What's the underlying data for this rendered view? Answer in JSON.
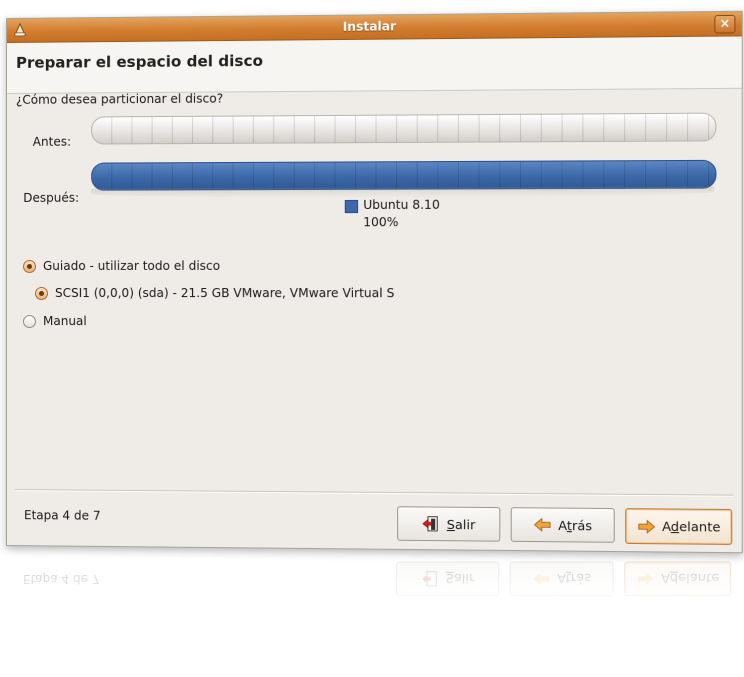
{
  "window": {
    "title": "Instalar",
    "close_label": "×"
  },
  "page": {
    "title": "Preparar el espacio del disco",
    "question": "¿Cómo desea particionar el disco?"
  },
  "partition_bars": {
    "before_label": "Antes:",
    "after_label": "Después:",
    "after_color": "#3d68a8",
    "legend": {
      "name": "Ubuntu 8.10",
      "percent": "100%"
    }
  },
  "options": [
    {
      "label": "Guiado - utilizar todo el disco",
      "selected": true
    },
    {
      "label": "SCSI1 (0,0,0) (sda) - 21.5 GB VMware, VMware Virtual S",
      "selected": true
    },
    {
      "label": "Manual",
      "selected": false
    }
  ],
  "footer": {
    "step": "Etapa 4 de 7",
    "quit_mnemonic": "S",
    "quit_rest": "alir",
    "back_prefix": "A",
    "back_mnemonic": "t",
    "back_rest": "rás",
    "next_prefix": "A",
    "next_mnemonic": "d",
    "next_rest": "elante"
  },
  "colors": {
    "titlebar": "#d27c2e",
    "window_bg": "#efebe6",
    "accent": "#e9b27a"
  }
}
